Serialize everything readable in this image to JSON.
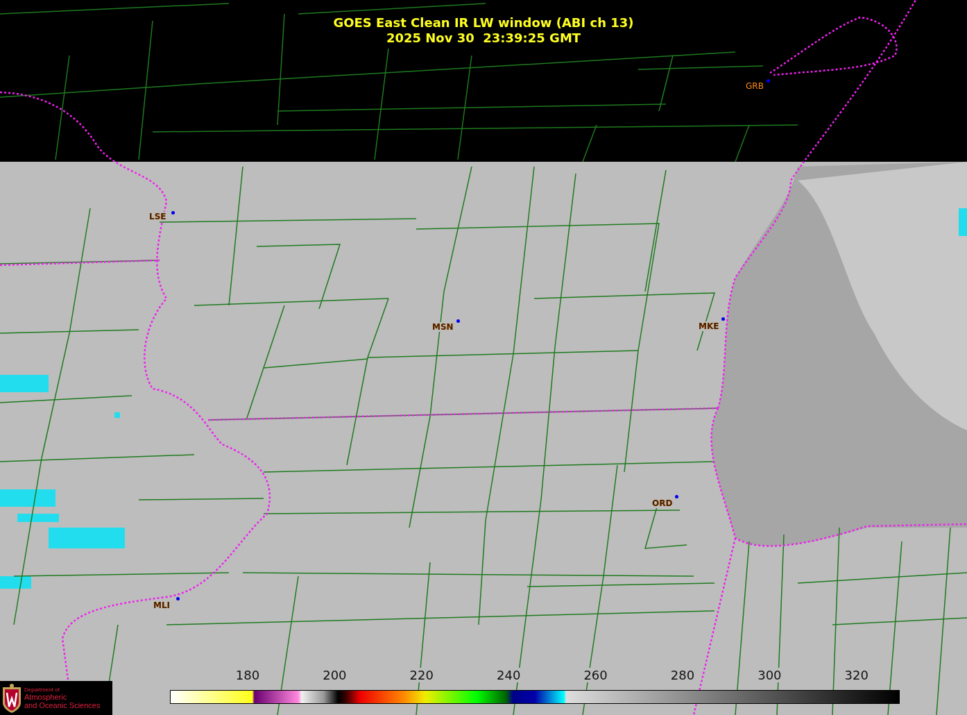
{
  "title": {
    "product": "GOES East Clean IR LW window (ABI ch 13)",
    "timestamp": "2025 Nov 30  23:39:25 GMT"
  },
  "stations": [
    {
      "label": "GRB"
    },
    {
      "label": "LSE"
    },
    {
      "label": "MSN"
    },
    {
      "label": "MKE"
    },
    {
      "label": "ORD"
    },
    {
      "label": "MLI"
    }
  ],
  "colorbar": {
    "ticks": [
      "180",
      "200",
      "220",
      "240",
      "260",
      "280",
      "300",
      "320"
    ]
  },
  "logo": {
    "line_1": "Department of",
    "line_2": "Atmospheric",
    "line_3": "and Oceanic Sciences"
  }
}
